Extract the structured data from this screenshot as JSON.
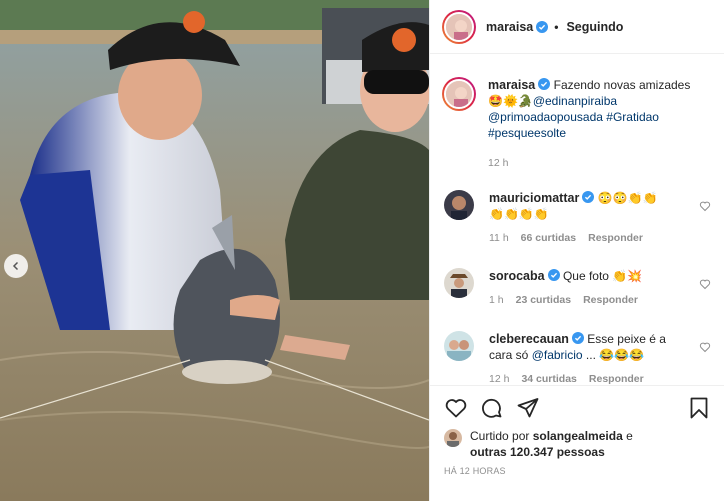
{
  "post": {
    "author": "maraisa",
    "follow_status": "Seguindo",
    "caption_author": "maraisa",
    "caption_text": "Fazendo novas amizades",
    "caption_emojis_1": "🤩🌞🐊",
    "caption_tag_1": "@edinanpiraiba",
    "caption_tag_2": "@primoadaopousada",
    "caption_hashtag_1": "#Gratidao",
    "caption_hashtag_2": "#pesqueesolte",
    "caption_time": "12 h"
  },
  "comments": [
    {
      "user": "mauriciomattar",
      "text_line1": "😳😳👏👏",
      "text_line2": "👏👏👏👏",
      "time": "11 h",
      "likes": "66 curtidas",
      "reply": "Responder"
    },
    {
      "user": "sorocaba",
      "text_line1": "Que foto 👏💥",
      "time": "1 h",
      "likes": "23 curtidas",
      "reply": "Responder"
    },
    {
      "user": "cleberecauan",
      "text_line1": "Esse peixe é a",
      "text_line2_prefix": "cara só ",
      "text_line2_tag": "@fabricio",
      "text_line2_suffix": " ... 😂😂😂",
      "time": "12 h",
      "likes": "34 curtidas",
      "reply": "Responder"
    }
  ],
  "likes": {
    "prefix": "Curtido por ",
    "user": "solangealmeida",
    "mid": " e",
    "others": "outras 120.347 pessoas"
  },
  "timestamp": "HÁ 12 HORAS",
  "icons": {
    "heart": "heart-icon",
    "comment": "comment-icon",
    "share": "share-icon",
    "save": "save-icon",
    "verified": "verified-badge-icon",
    "prev": "chevron-left-icon"
  },
  "colors": {
    "verified": "#3897f0",
    "link": "#00376b",
    "muted": "#8e8e8e"
  }
}
